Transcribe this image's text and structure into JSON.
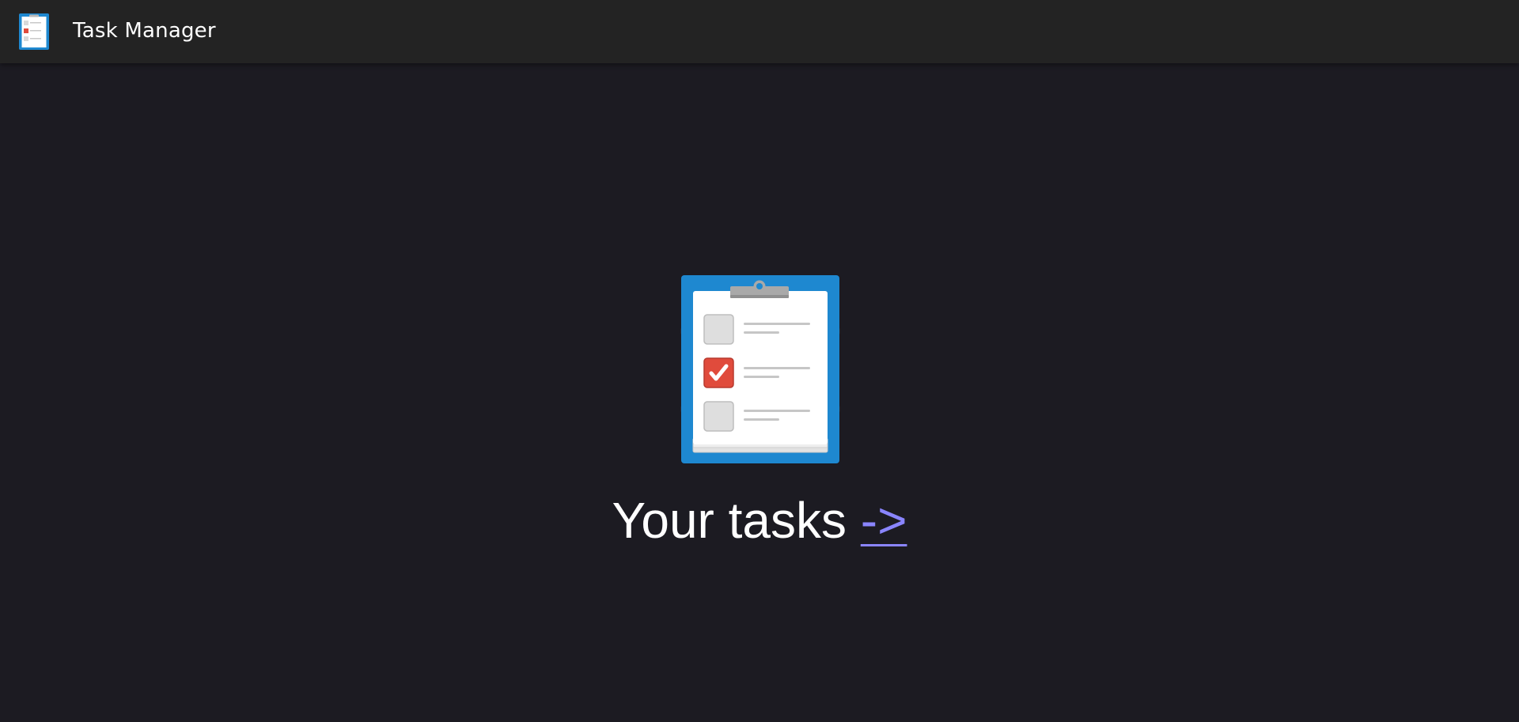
{
  "app_bar": {
    "title": "Task Manager",
    "logo_icon": "clipboard-checklist-icon"
  },
  "hero": {
    "illustration_icon": "clipboard-checklist-icon",
    "text": "Your tasks ",
    "link_label": "->",
    "checklist": [
      {
        "checked": false
      },
      {
        "checked": true
      },
      {
        "checked": false
      }
    ]
  },
  "colors": {
    "background": "#1c1b22",
    "app_bar": "#232323",
    "link": "#8a85ff",
    "clipboard_blue": "#1e88d0",
    "check_red": "#e04b3c"
  }
}
